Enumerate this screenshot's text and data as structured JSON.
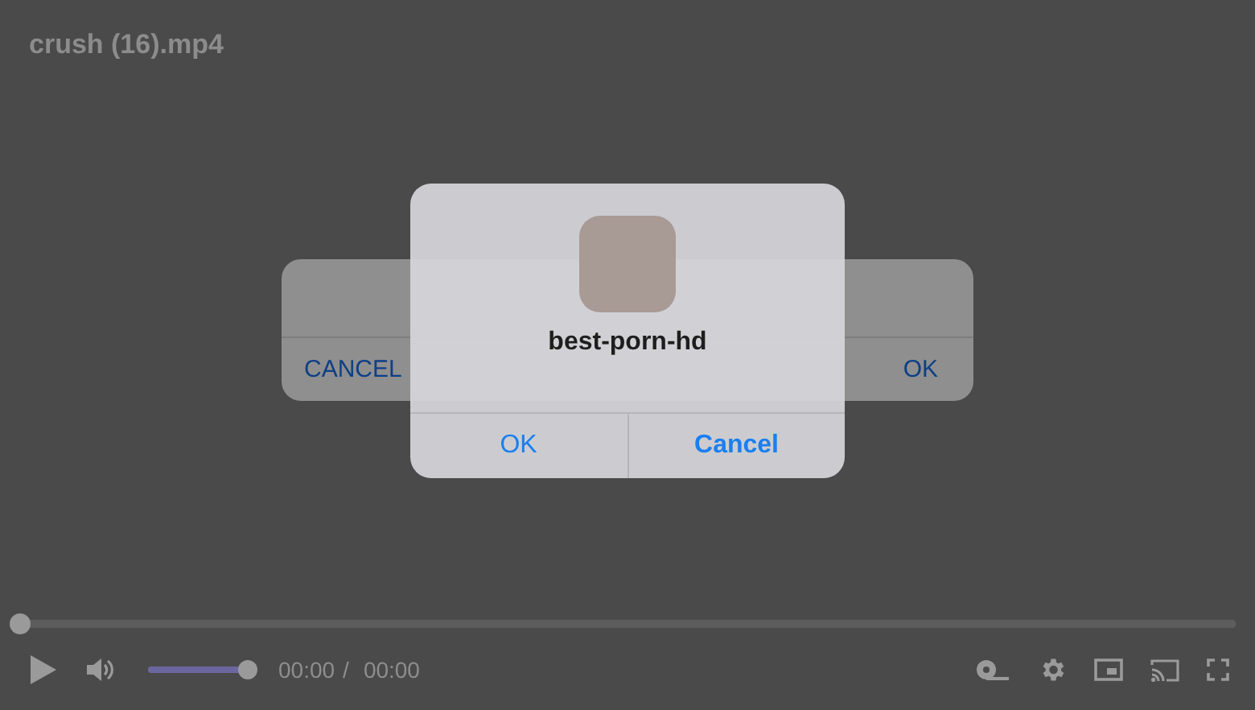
{
  "video": {
    "title": "crush (16).mp4"
  },
  "back_dialog": {
    "buttons": [
      "CANCEL",
      "OK"
    ]
  },
  "dialog": {
    "title": "best-porn-hd",
    "buttons": [
      {
        "label": "OK",
        "kind": "normal"
      },
      {
        "label": "Cancel",
        "kind": "bold"
      }
    ]
  },
  "controls": {
    "progress": {
      "level": 0
    },
    "volume": {
      "level": 1
    },
    "current_time": "00:00",
    "separator": "/",
    "duration": "00:00"
  }
}
